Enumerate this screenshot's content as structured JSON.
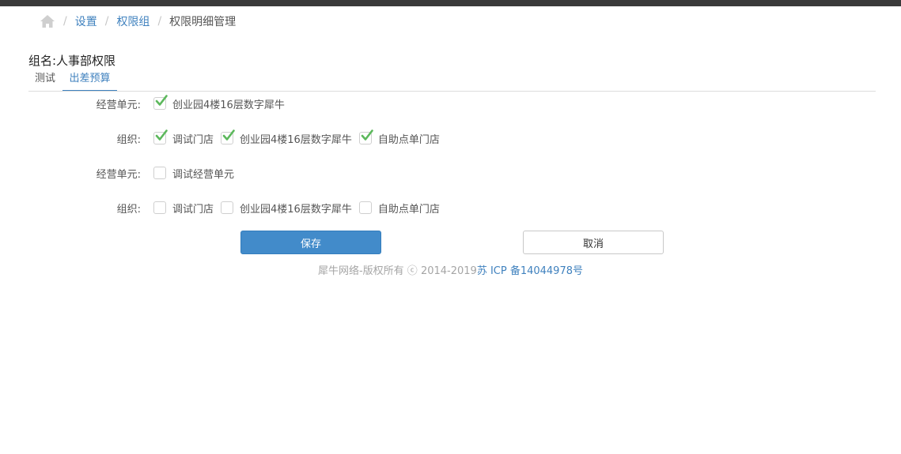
{
  "breadcrumb": {
    "items": [
      "设置",
      "权限组",
      "权限明细管理"
    ]
  },
  "group_title": "组名:人事部权限",
  "tabs": [
    "测试",
    "出差预算"
  ],
  "rows": [
    {
      "label": "经营单元:",
      "items": [
        {
          "label": "创业园4楼16层数字犀牛",
          "checked": true
        }
      ]
    },
    {
      "label": "组织:",
      "items": [
        {
          "label": "调试门店",
          "checked": true
        },
        {
          "label": "创业园4楼16层数字犀牛",
          "checked": true
        },
        {
          "label": "自助点单门店",
          "checked": true
        }
      ]
    },
    {
      "label": "经营单元:",
      "items": [
        {
          "label": "调试经营单元",
          "checked": false
        }
      ]
    },
    {
      "label": "组织:",
      "items": [
        {
          "label": "调试门店",
          "checked": false
        },
        {
          "label": "创业园4楼16层数字犀牛",
          "checked": false
        },
        {
          "label": "自助点单门店",
          "checked": false
        }
      ]
    }
  ],
  "buttons": {
    "save": "保存",
    "cancel": "取消"
  },
  "footer": {
    "copyright": "犀牛网络-版权所有 ⓒ 2014-2019",
    "icp": "苏 ICP 备14044978号"
  },
  "colors": {
    "accent": "#3f81be",
    "primary_button": "#428bca",
    "check": "#5cb85c"
  }
}
